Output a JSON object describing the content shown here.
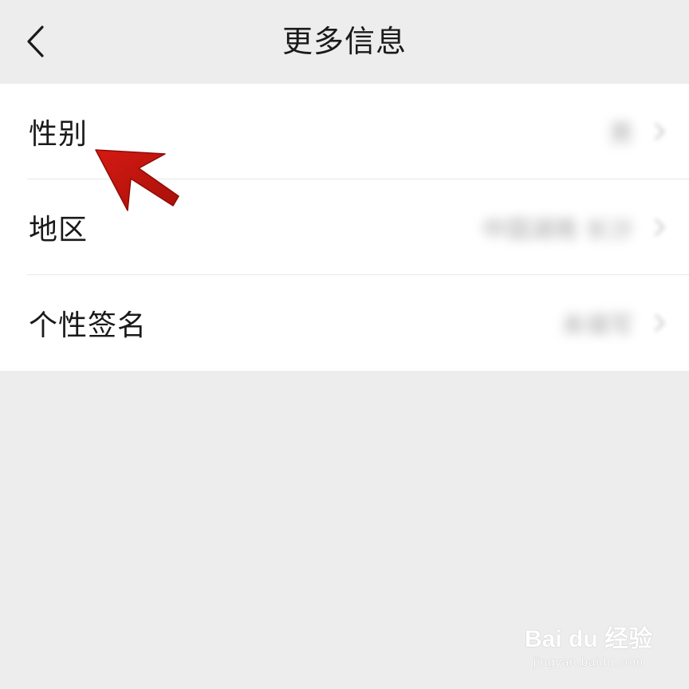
{
  "nav": {
    "back_icon": "chevron-left-icon",
    "title": "更多信息"
  },
  "rows": [
    {
      "label": "性别",
      "value": "男"
    },
    {
      "label": "地区",
      "value": "中国湖南 长沙"
    },
    {
      "label": "个性签名",
      "value": "未填写"
    }
  ],
  "annotation": {
    "color": "#c0160f",
    "icon": "arrow-annotation-icon"
  },
  "watermark": {
    "logo": "Bai du 经验",
    "url": "jingyan.baidu.com"
  }
}
